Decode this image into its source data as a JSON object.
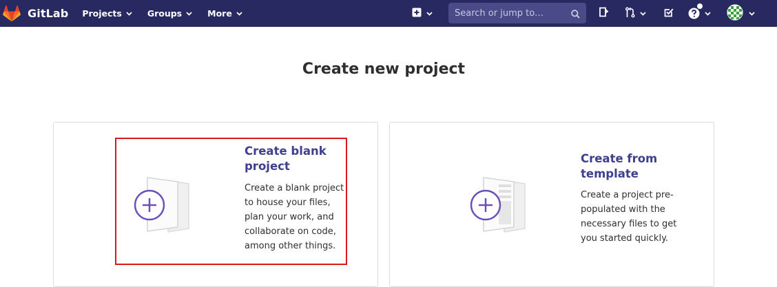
{
  "navbar": {
    "brand": "GitLab",
    "menus": [
      {
        "label": "Projects"
      },
      {
        "label": "Groups"
      },
      {
        "label": "More"
      }
    ],
    "search": {
      "placeholder": "Search or jump to…"
    },
    "icons": [
      "plus-square-icon",
      "issues-icon",
      "merge-request-icon",
      "todo-check-icon",
      "help-icon",
      "user-avatar"
    ]
  },
  "page": {
    "title": "Create new project"
  },
  "cards": [
    {
      "title_line1": "Create blank",
      "title_line2": "project",
      "desc_lines": [
        "Create a blank project",
        "to house your files,",
        "plan your work, and",
        "collaborate on code,",
        "among other things."
      ]
    },
    {
      "title_line1": "Create from",
      "title_line2": "template",
      "desc_lines": [
        "Create a project pre-",
        "populated with the",
        "necessary files to get",
        "you started quickly."
      ]
    }
  ],
  "colors": {
    "navbar": "#292961",
    "accent": "#6b4fbb",
    "card_title": "#3f3f8f",
    "highlight": "#d9171c"
  }
}
